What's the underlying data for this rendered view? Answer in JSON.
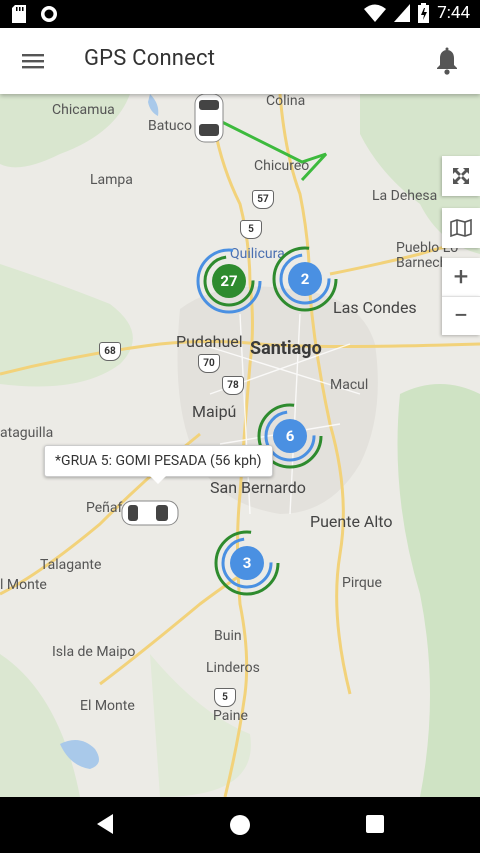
{
  "status_bar": {
    "time": "7:44"
  },
  "app_bar": {
    "title": "GPS Connect"
  },
  "map": {
    "places": {
      "chicamua": "Chicamua",
      "batuco": "Batuco",
      "colina": "Colina",
      "lampa": "Lampa",
      "chicureo": "Chicureo",
      "la_dehesa": "La Dehesa",
      "pueblo_lo": "Pueblo Lo",
      "barnech": "Barnech",
      "quilicura": "Quilicura",
      "las_condes": "Las Condes",
      "pudahuel": "Pudahuel",
      "santiago": "Santiago",
      "macul": "Macul",
      "maipu": "Maipú",
      "ataguilla": "ataguilla",
      "san_bernardo": "San Bernardo",
      "penaf": "Peñaf",
      "puente_alto": "Puente Alto",
      "talagante": "Talagante",
      "el_monte": "l Monte",
      "pirque": "Pirque",
      "buin": "Buin",
      "isla_de_maipo": "Isla de Maipo",
      "linderos": "Linderos",
      "el_monte2": "El Monte",
      "paine": "Paine"
    },
    "shields": [
      "57",
      "5",
      "68",
      "70",
      "78",
      "5"
    ],
    "clusters": [
      {
        "count": "27",
        "color": "#2e8b2e",
        "ring": "#4a90e2"
      },
      {
        "count": "2",
        "color": "#4a90e2",
        "ring": "#2e8b2e"
      },
      {
        "count": "6",
        "color": "#4a90e2",
        "ring": "#2e8b2e"
      },
      {
        "count": "3",
        "color": "#4a90e2",
        "ring": "#2e8b2e"
      }
    ],
    "tooltip": "*GRUA 5: GOMI PESADA (56 kph)"
  },
  "controls": {
    "fullscreen": "fullscreen-icon",
    "map_type": "map-icon",
    "zoom_in": "+",
    "zoom_out": "−"
  },
  "colors": {
    "accent_green": "#2e8b2e",
    "accent_blue": "#4a90e2",
    "route": "#3dba3d"
  }
}
